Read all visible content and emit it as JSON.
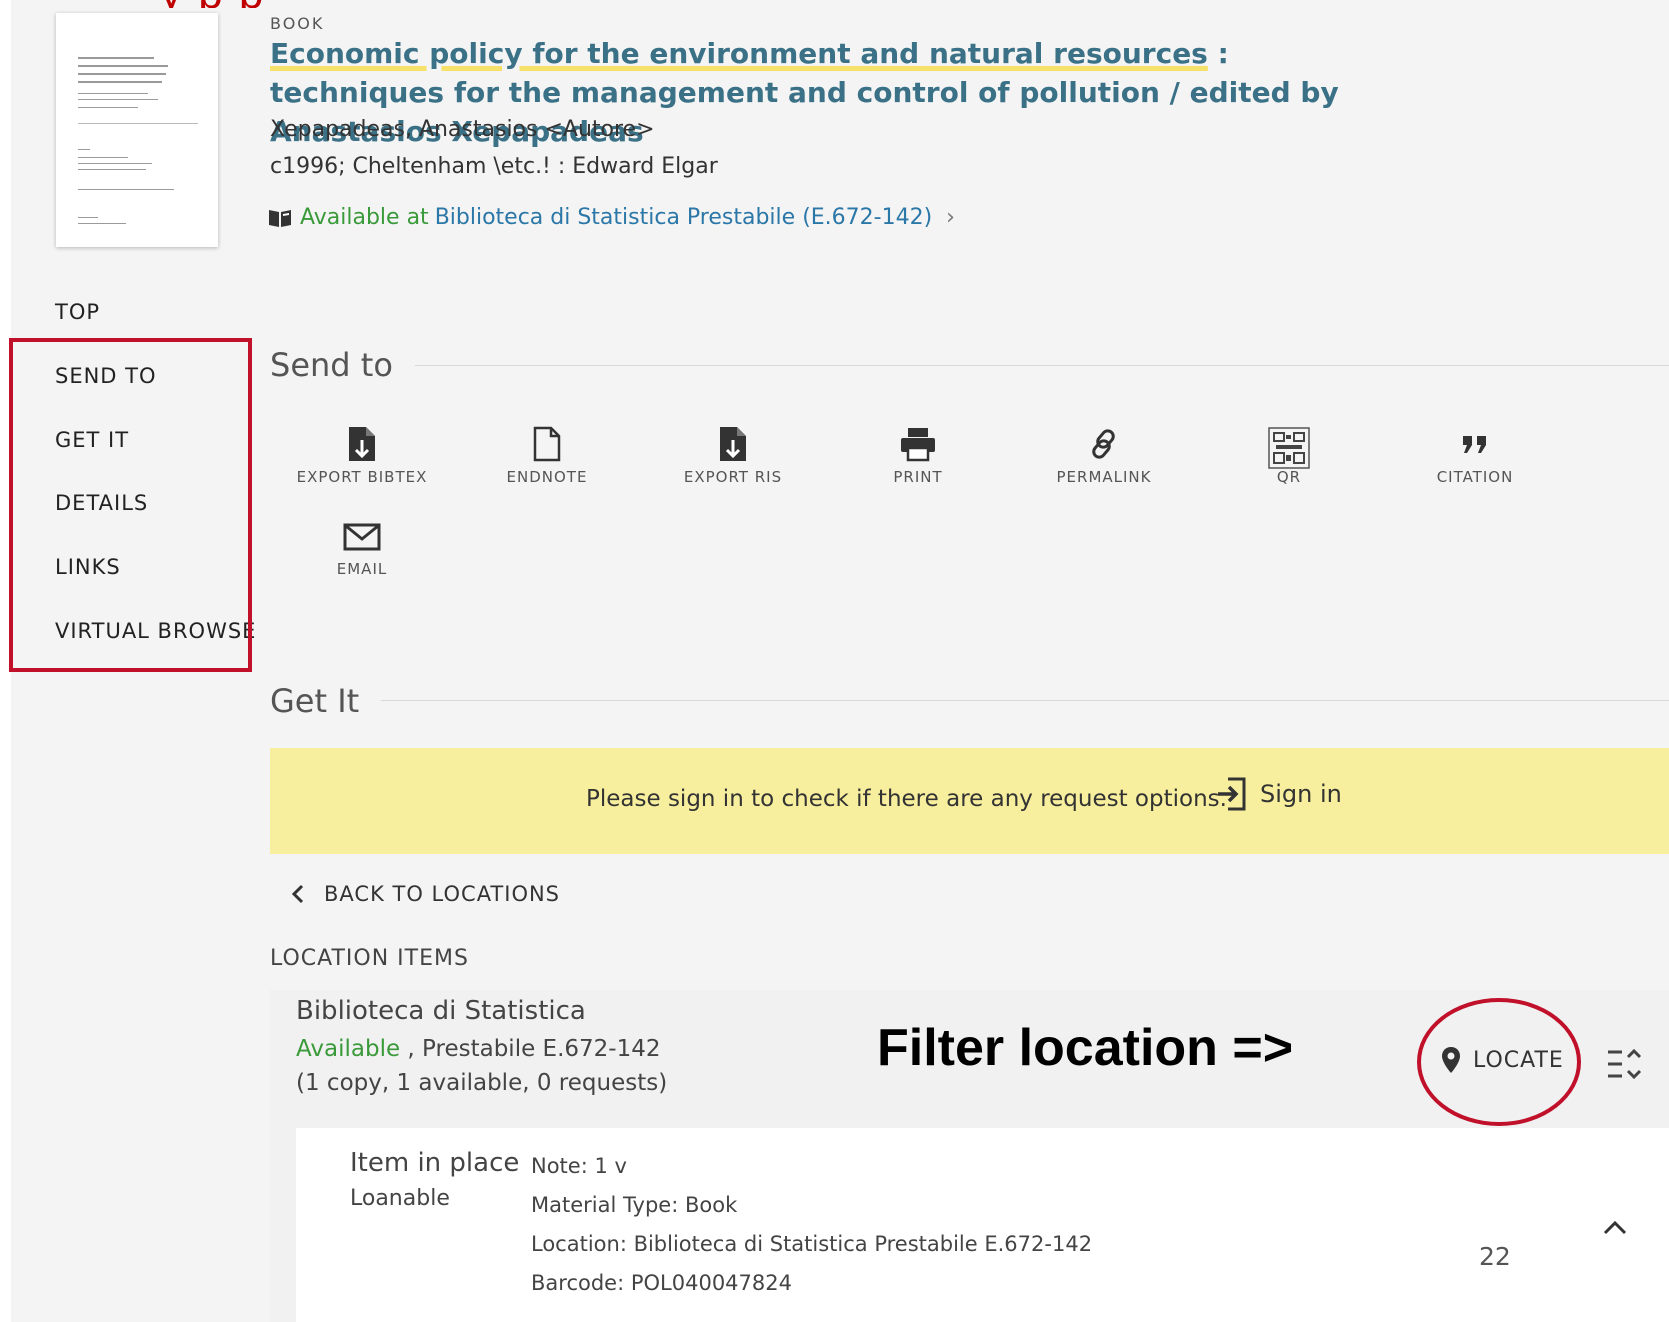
{
  "record": {
    "type": "BOOK",
    "title_part1": "Economic policy for the environment and natural resources",
    "title_part2": " : techniques for the management and control of pollution / edited by Anastasios Xepapadeas",
    "author": "Xepapadeas, Anastasios <Autore>",
    "publication": "c1996; Cheltenham \\etc.! : Edward Elgar",
    "availability_label": "Available at",
    "availability_link": "Biblioteca di Statistica  Prestabile (E.672-142)",
    "availability_chevron": "›"
  },
  "nav": {
    "items": [
      {
        "label": "TOP"
      },
      {
        "label": "SEND TO"
      },
      {
        "label": "GET IT"
      },
      {
        "label": "DETAILS"
      },
      {
        "label": "LINKS"
      },
      {
        "label": "VIRTUAL BROWSE"
      }
    ]
  },
  "send_to": {
    "title": "Send to",
    "actions": [
      {
        "label": "EXPORT BIBTEX",
        "icon": "file-export-icon"
      },
      {
        "label": "ENDNOTE",
        "icon": "file-icon"
      },
      {
        "label": "EXPORT RIS",
        "icon": "file-export-icon"
      },
      {
        "label": "PRINT",
        "icon": "printer-icon"
      },
      {
        "label": "PERMALINK",
        "icon": "link-icon"
      },
      {
        "label": "QR",
        "icon": "qr-code-icon"
      },
      {
        "label": "CITATION",
        "icon": "quote-icon"
      },
      {
        "label": "EMAIL",
        "icon": "envelope-icon"
      }
    ]
  },
  "get_it": {
    "title": "Get It",
    "signin_message": "Please sign in to check if there are any request options.",
    "signin_button": "Sign in",
    "back_label": "BACK TO LOCATIONS",
    "location_items_label": "LOCATION ITEMS",
    "location": {
      "name": "Biblioteca di Statistica",
      "status": "Available",
      "shelf": " , Prestabile E.672-142",
      "counts": "(1 copy, 1 available, 0 requests)",
      "locate_label": "LOCATE"
    },
    "item": {
      "status": "Item in place",
      "policy": "Loanable",
      "note": "Note: 1 v",
      "material_type": "Material Type: Book",
      "location": "Location: Biblioteca di Statistica Prestabile E.672-142",
      "barcode": "Barcode: POL040047824",
      "count": "22"
    }
  },
  "annotation": {
    "filter_label": "Filter location =>",
    "banner_text": "y   p                      p"
  },
  "colors": {
    "accent_title": "#3a7186",
    "link": "#2b77a8",
    "available": "#3a9a3a",
    "annotation_red": "#c0102a",
    "signin_bg": "#f7ef9e"
  }
}
